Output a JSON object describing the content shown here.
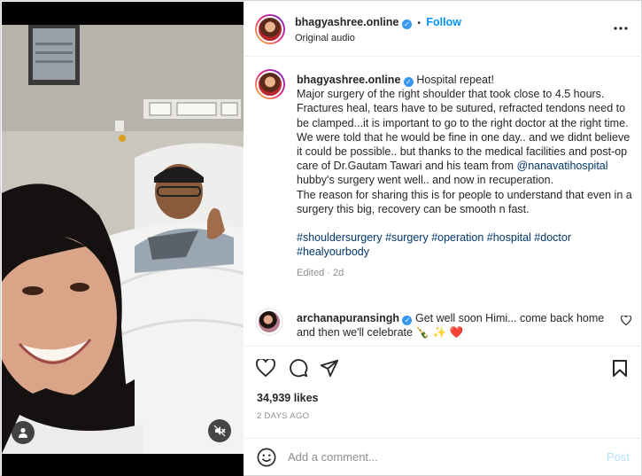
{
  "media": {
    "icons": {
      "user": "user-tag-icon",
      "sound": "muted-speaker-icon"
    }
  },
  "header": {
    "username": "bhagyashree.online",
    "separator": "•",
    "follow_label": "Follow",
    "audio": "Original audio",
    "more": "more-options-icon"
  },
  "caption": {
    "username": "bhagyashree.online",
    "title": "Hospital repeat!",
    "body": "Major surgery of the right shoulder that took close to 4.5 hours. Fractures heal, tears have to be sutured, refracted tendons need to be clamped...it is important to go to the right doctor at the right time. We were told that he would be fine in one day.. and we didnt believe it could be possible.. but thanks to the medical facilities and post-op care of Dr.Gautam Tawari and his team from",
    "mention": "@nanavatihospital",
    "body2": " hubby's surgery went well.. and now in recuperation.",
    "body3": "The reason for sharing this is for people to understand that even in a surgery this big, recovery can be smooth n fast.",
    "hashtags": [
      "#shouldersurgery",
      "#surgery",
      "#operation",
      "#hospital",
      "#doctor",
      "#healyourbody"
    ],
    "meta": "Edited · 2d"
  },
  "comment": {
    "username": "archanapuransingh",
    "text": "Get well soon Himi... come back home and then we'll celebrate 🍾 ✨ ❤️"
  },
  "actions": {
    "icons": [
      "heart-icon",
      "comment-icon",
      "share-icon",
      "bookmark-icon"
    ],
    "likes": "34,939 likes",
    "date": "2 DAYS AGO"
  },
  "add_comment": {
    "placeholder": "Add a comment...",
    "post_label": "Post"
  },
  "colors": {
    "accent": "#0095f6",
    "verified": "#3897f0",
    "hashtag": "#00376b",
    "muted": "#8e8e8e"
  }
}
